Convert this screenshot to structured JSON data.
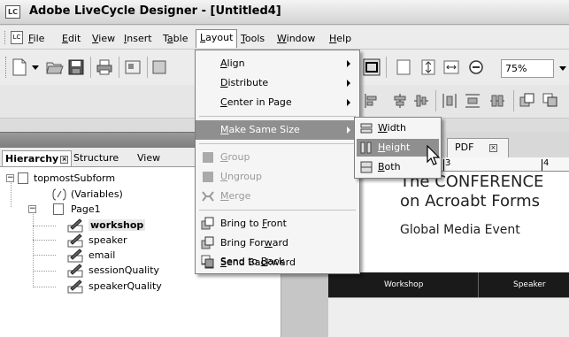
{
  "window": {
    "app_icon": "LC",
    "title": "Adobe LiveCycle Designer - [Untitled4]"
  },
  "menubar": {
    "items": [
      {
        "label": "File",
        "mnemonic": "F"
      },
      {
        "label": "Edit",
        "mnemonic": "E"
      },
      {
        "label": "View",
        "mnemonic": "V"
      },
      {
        "label": "Insert",
        "mnemonic": "I"
      },
      {
        "label": "Table",
        "mnemonic": "a"
      },
      {
        "label": "Layout",
        "mnemonic": "L"
      },
      {
        "label": "Tools",
        "mnemonic": "T"
      },
      {
        "label": "Window",
        "mnemonic": "W"
      },
      {
        "label": "Help",
        "mnemonic": "H"
      }
    ],
    "active": "Layout"
  },
  "toolbar": {
    "zoom": "75%"
  },
  "left_panel": {
    "tabs": [
      "Hierarchy",
      "Structure",
      "View"
    ],
    "active_tab": "Hierarchy",
    "tree": [
      {
        "label": "topmostSubform",
        "level": 0,
        "type": "subform",
        "expanded": true
      },
      {
        "label": "(Variables)",
        "level": 1,
        "type": "variables"
      },
      {
        "label": "Page1",
        "level": 1,
        "type": "page",
        "expanded": true
      },
      {
        "label": "workshop",
        "level": 2,
        "type": "field",
        "selected": true
      },
      {
        "label": "speaker",
        "level": 2,
        "type": "field"
      },
      {
        "label": "email",
        "level": 2,
        "type": "field"
      },
      {
        "label": "sessionQuality",
        "level": 2,
        "type": "field"
      },
      {
        "label": "speakerQuality",
        "level": 2,
        "type": "field"
      }
    ]
  },
  "design": {
    "tab_label": "PDF",
    "ruler_marks": [
      "3",
      "4"
    ],
    "heading_line1": "The CONFERENCE",
    "heading_line2": "on Acroabt Forms",
    "subheading": "Global Media Event",
    "table_headers": [
      "Workshop",
      "Speaker"
    ]
  },
  "layout_menu": {
    "items": [
      {
        "label": "Align",
        "mnemonic": "A",
        "submenu": true,
        "enabled": true
      },
      {
        "label": "Distribute",
        "mnemonic": "D",
        "submenu": true,
        "enabled": true
      },
      {
        "label": "Center in Page",
        "mnemonic": "C",
        "submenu": true,
        "enabled": true
      },
      {
        "label": "Make Same Size",
        "mnemonic": "M",
        "submenu": true,
        "enabled": true,
        "highlighted": true
      },
      {
        "label": "Group",
        "mnemonic": "G",
        "enabled": false
      },
      {
        "label": "Ungroup",
        "mnemonic": "U",
        "enabled": false
      },
      {
        "label": "Merge",
        "mnemonic": "M",
        "enabled": false
      },
      {
        "label": "Bring to Front",
        "mnemonic": "F",
        "enabled": true
      },
      {
        "label": "Bring Forward",
        "mnemonic": "w",
        "enabled": true
      },
      {
        "label": "Send Backward",
        "mnemonic": "S",
        "enabled": true
      },
      {
        "label": "Send to Back",
        "mnemonic": "B",
        "enabled": true
      }
    ]
  },
  "size_submenu": {
    "items": [
      {
        "label": "Width",
        "mnemonic": "W"
      },
      {
        "label": "Height",
        "mnemonic": "H",
        "highlighted": true
      },
      {
        "label": "Both",
        "mnemonic": "B"
      }
    ]
  }
}
